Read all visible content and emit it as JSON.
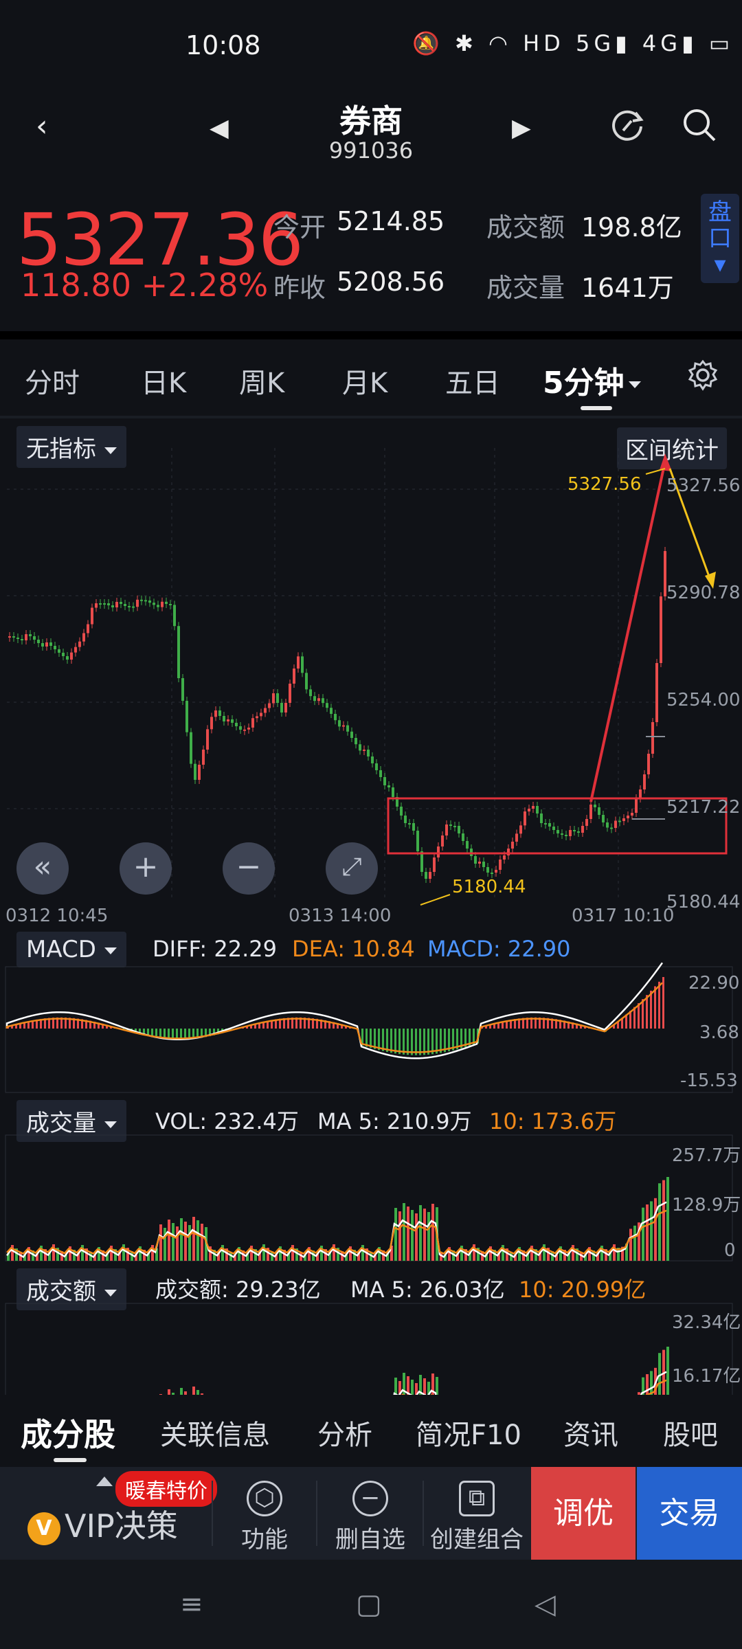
{
  "status": {
    "time": "10:08",
    "icons_text": "🔕 ✱ ◠ HD 5G▮ 4G▮ ▭"
  },
  "header": {
    "name": "券商",
    "code": "991036"
  },
  "quote": {
    "price": "5327.36",
    "change": "118.80",
    "change_pct": "+2.28%",
    "open_label": "今开",
    "open_value": "5214.85",
    "prev_label": "昨收",
    "prev_value": "5208.56",
    "amount_label": "成交额",
    "amount_value": "198.8亿",
    "volume_label": "成交量",
    "volume_value": "1641万",
    "pankou": "盘口"
  },
  "period_tabs": [
    "分时",
    "日K",
    "周K",
    "月K",
    "五日",
    "5分钟"
  ],
  "chart": {
    "indicator": "无指标",
    "range_stats": "区间统计",
    "high_label": "5327.56",
    "low_label": "5180.44",
    "y_ticks": [
      "5327.56",
      "5290.78",
      "5254.00",
      "5217.22",
      "5180.44"
    ],
    "x_ticks": [
      "0312  10:45",
      "0313  14:00",
      "0317  10:10"
    ],
    "colors": {
      "up": "#e94c4c",
      "down": "#3fae49",
      "highlight": "#f2c21b",
      "box": "#e0303a"
    }
  },
  "macd": {
    "selector": "MACD",
    "diff": "DIFF: 22.29",
    "dea": "DEA: 10.84",
    "macd": "MACD: 22.90",
    "y_ticks": [
      "22.90",
      "3.68",
      "-15.53"
    ]
  },
  "vol": {
    "selector": "成交量",
    "vol": "VOL: 232.4万",
    "ma5": "MA 5: 210.9万",
    "ma10": "10: 173.6万",
    "y_ticks": [
      "257.7万",
      "128.9万",
      "0"
    ]
  },
  "amt": {
    "selector": "成交额",
    "amt": "成交额: 29.23亿",
    "ma5": "MA 5: 26.03亿",
    "ma10": "10: 20.99亿",
    "y_ticks": [
      "32.34亿",
      "16.17亿"
    ]
  },
  "bottom_tabs": [
    "成分股",
    "关联信息",
    "分析",
    "简况F10",
    "资讯",
    "股吧"
  ],
  "toolbar": {
    "vip": "VIP决策",
    "promo": "暖春特价",
    "func": "功能",
    "remove": "删自选",
    "combo": "创建组合",
    "tune": "调优",
    "trade": "交易"
  }
}
